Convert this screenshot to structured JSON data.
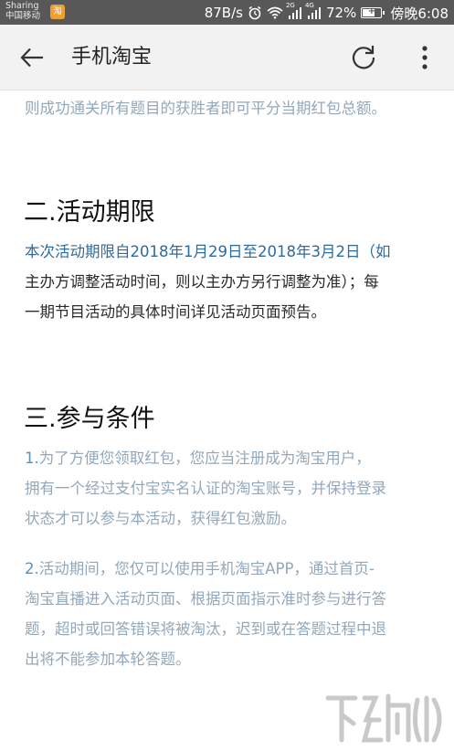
{
  "status_bar": {
    "carrier_line1": "Sharing",
    "carrier_line2": "中国移动",
    "net_speed": "87B/s",
    "net_type_1": "2G",
    "net_type_2": "4G",
    "battery_percent": "72%",
    "battery_level": 0.72,
    "time": "傍晚6:08"
  },
  "app_bar": {
    "title": "手机淘宝"
  },
  "content": {
    "intro_line": "则成功通关所有题目的获胜者即可平分当期红包总额。",
    "section2": {
      "heading": "二.活动期限",
      "lines": [
        "本次活动期限自2018年1月29日至2018年3月2日（如",
        "主办方调整活动时间，则以主办方另行调整为准）；每",
        "一期节目活动的具体时间详见活动页面预告。"
      ]
    },
    "section3": {
      "heading": "三.参与条件",
      "item1": {
        "number": "1.",
        "lines": [
          "为了方便您领取红包，您应当注册成为淘宝用户，",
          "拥有一个经过支付宝实名认证的淘宝账号，并保持登录",
          "状态才可以参与本活动，获得红包激励。"
        ]
      },
      "item2": {
        "number": "2.",
        "lines": [
          "活动期间，您仅可以使用手机淘宝APP，通过首页-",
          "淘宝直播进入活动页面、根据页面指示准时参与进行答",
          "题，超时或回答错误将被淘汰，迟到或在答题过程中退",
          "出将不能参加本轮答题。"
        ]
      }
    }
  },
  "colors": {
    "status_bar": "#585858",
    "app_bar": "#f2f2f2",
    "link_blue": "#2d6b9f"
  },
  "icons": {
    "back": "arrow-left-icon",
    "refresh": "refresh-icon",
    "more": "more-vertical-icon",
    "alarm": "alarm-icon",
    "wifi": "wifi-icon",
    "signal": "signal-icon",
    "battery": "battery-icon"
  }
}
